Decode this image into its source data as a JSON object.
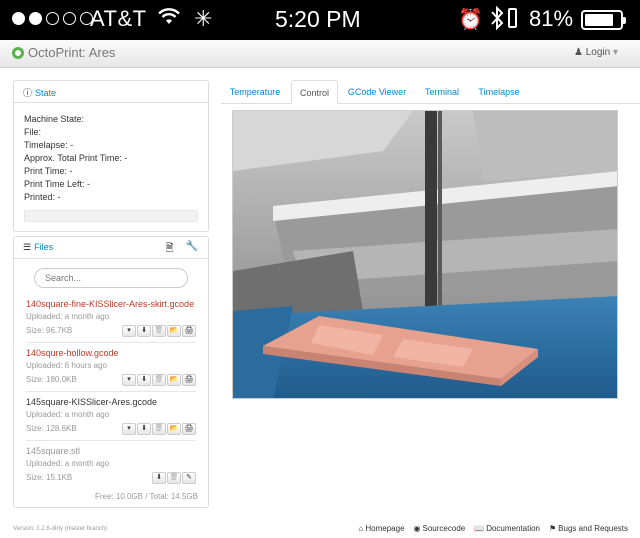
{
  "statusbar": {
    "signal_bars": 5,
    "signal_filled": 2,
    "carrier": "AT&T",
    "time": "5:20 PM",
    "battery_pct": "81%",
    "battery_level": 0.81
  },
  "navbar": {
    "brand": "OctoPrint: Ares",
    "login": "Login"
  },
  "state": {
    "title": "State",
    "machine_state": "Machine State:",
    "file": "File:",
    "timelapse": "Timelapse: -",
    "approx_total": "Approx. Total Print Time: -",
    "print_time": "Print Time: -",
    "print_time_left": "Print Time Left: -",
    "printed": "Printed: -"
  },
  "files": {
    "title": "Files",
    "search_placeholder": "Search...",
    "items": [
      {
        "name": "140square-fine-KISSlicer-Ares-skirt.gcode",
        "uploaded": "Uploaded: a month ago",
        "size": "Size: 96.7KB"
      },
      {
        "name": "140squre-hollow.gcode",
        "uploaded": "Uploaded: 6 hours ago",
        "size": "Size: 180.0KB"
      },
      {
        "name": "145square-KISSlicer-Ares.gcode",
        "uploaded": "Uploaded: a month ago",
        "size": "Size: 128.6KB"
      },
      {
        "name": "145square.stl",
        "uploaded": "Uploaded: a month ago",
        "size": "Size: 15.1KB"
      }
    ],
    "free": "Free: 10.0GB / Total: 14.5GB"
  },
  "tabs": [
    "Temperature",
    "Control",
    "GCode Viewer",
    "Terminal",
    "Timelapse"
  ],
  "active_tab": "Control",
  "footer": {
    "version": "Version: 1.2.6-dirty (master branch)",
    "links": [
      "Homepage",
      "Sourcecode",
      "Documentation",
      "Bugs and Requests"
    ]
  },
  "colors": {
    "link": "#0088cc",
    "file_error": "#c0392b",
    "bed_blue": "#2a6a9c",
    "print_pink": "#e9a393"
  },
  "icons": [
    "wifi-icon",
    "activity-spinner-icon",
    "alarm-icon",
    "bluetooth-icon",
    "battery-icon",
    "user-icon",
    "info-icon",
    "list-icon",
    "file-icon",
    "wrench-icon",
    "select-caret-icon",
    "download-icon",
    "trash-icon",
    "folder-open-icon",
    "print-icon",
    "slice-icon",
    "home-icon",
    "github-icon",
    "book-icon",
    "flag-icon"
  ]
}
